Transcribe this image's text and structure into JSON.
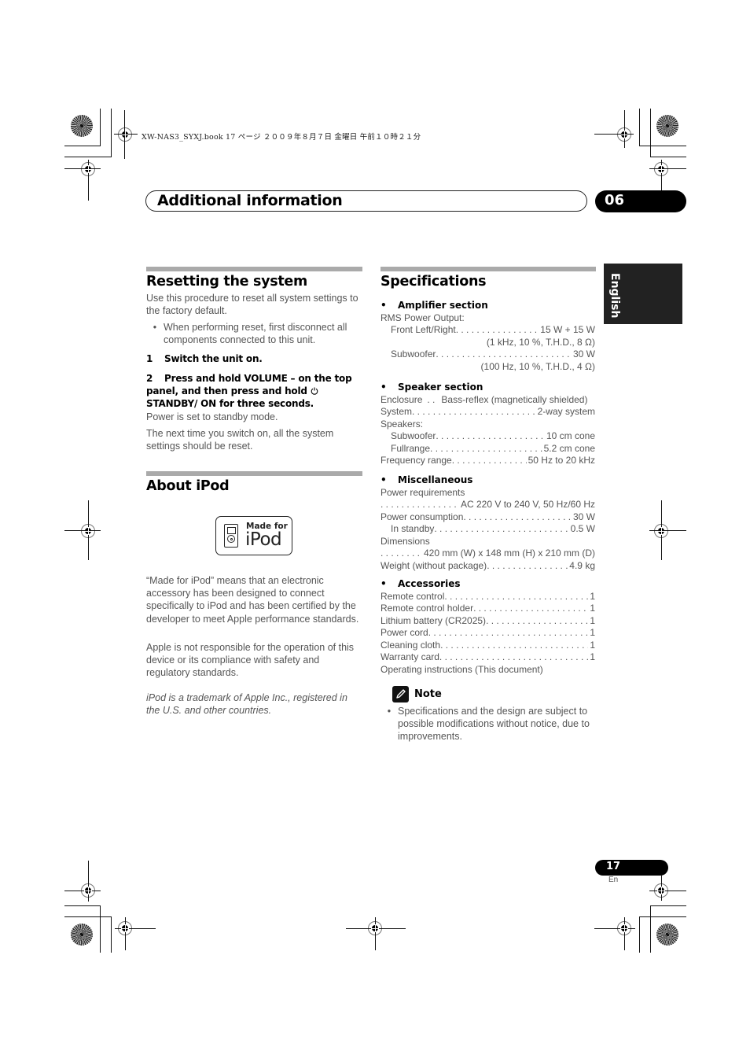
{
  "slug": {
    "text": "XW-NAS3_SYXJ.book  17 ページ  ２００９年８月７日  金曜日  午前１０時２１分"
  },
  "header": {
    "title": "Additional information",
    "chapter": "06"
  },
  "language_tab": "English",
  "resetting": {
    "title": "Resetting the system",
    "intro": "Use this procedure to reset all system settings to the factory default.",
    "bullet": "When performing reset, first disconnect all components connected to this unit.",
    "step1_num": "1",
    "step1": "Switch the unit on.",
    "step2_num": "2",
    "step2_a": "Press and hold VOLUME – on the top panel, and then press and hold",
    "standby_icon": "power-icon",
    "step2_b": "STANDBY/ ON for three seconds.",
    "result": "Power is set to standby mode.",
    "next_time": "The next time you switch on, all the system settings should be reset."
  },
  "about_ipod": {
    "title": "About iPod",
    "badge_made_for": "Made for",
    "badge_ipod": "iPod",
    "para1": "“Made for iPod” means that an electronic accessory has been designed to connect specifically to iPod and has been certified by the developer to meet Apple performance standards.",
    "para2": "Apple is not responsible for the operation of this device or its compliance with safety and regulatory standards.",
    "trademark": "iPod is a trademark of Apple Inc., registered in the U.S. and other countries."
  },
  "specifications": {
    "title": "Specifications",
    "amplifier": {
      "heading": "Amplifier section",
      "rms_label": "RMS Power Output:",
      "front_label": "Front Left/Right",
      "front_value": "15 W + 15 W",
      "front_cond": "(1 kHz, 10 %, T.H.D., 8 Ω)",
      "sub_label": "Subwoofer",
      "sub_value": "30 W",
      "sub_cond": "(100 Hz, 10 %, T.H.D., 4 Ω)"
    },
    "speaker": {
      "heading": "Speaker section",
      "enclosure_label": "Enclosure",
      "enclosure_value": "Bass-reflex (magnetically shielded)",
      "system_label": "System",
      "system_value": "2-way system",
      "speakers_label": "Speakers:",
      "subwoofer_label": "Subwoofer",
      "subwoofer_value": "10 cm cone",
      "fullrange_label": "Fullrange",
      "fullrange_value": "5.2 cm cone",
      "freq_label": "Frequency range",
      "freq_value": "50 Hz to 20 kHz"
    },
    "misc": {
      "heading": "Miscellaneous",
      "power_req_label": "Power requirements",
      "power_req_value": "AC 220 V to 240 V, 50 Hz/60 Hz",
      "consumption_label": "Power consumption",
      "consumption_value": "30 W",
      "standby_label": "In standby",
      "standby_value": "0.5 W",
      "dimensions_label": "Dimensions",
      "dimensions_value": "420 mm (W) x 148 mm (H) x 210 mm (D)",
      "weight_label": "Weight (without package)",
      "weight_value": "4.9 kg"
    },
    "accessories": {
      "heading": "Accessories",
      "items": [
        {
          "label": "Remote control",
          "qty": "1"
        },
        {
          "label": "Remote control holder",
          "qty": "1"
        },
        {
          "label": "Lithium battery (CR2025)",
          "qty": "1"
        },
        {
          "label": "Power cord",
          "qty": "1"
        },
        {
          "label": "Cleaning cloth",
          "qty": "1"
        },
        {
          "label": "Warranty card",
          "qty": "1"
        }
      ],
      "last": "Operating instructions (This document)"
    },
    "note": {
      "label": "Note",
      "text": "Specifications and the design are subject to possible modifications without notice, due to improvements."
    }
  },
  "footer": {
    "page_number": "17",
    "page_lang": "En"
  }
}
